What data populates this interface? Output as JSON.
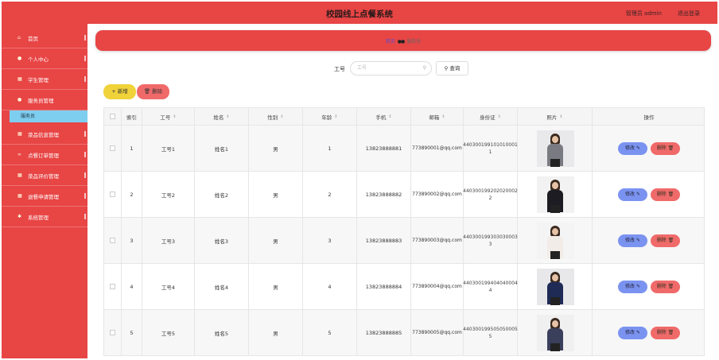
{
  "header": {
    "title": "校园线上点餐系统",
    "user": "管理员 admin",
    "logout": "退出登录"
  },
  "sidebar": {
    "items": [
      {
        "label": "首页",
        "icon": "home-icon",
        "glyph": "⌂"
      },
      {
        "label": "个人中心",
        "icon": "user-icon",
        "glyph": "●"
      },
      {
        "label": "学生管理",
        "icon": "grid-icon",
        "glyph": "▦"
      },
      {
        "label": "服务员管理",
        "icon": "user-icon",
        "glyph": "●"
      },
      {
        "label": "菜品信息管理",
        "icon": "grid-icon",
        "glyph": "▦"
      },
      {
        "label": "点餐订单管理",
        "icon": "link-icon",
        "glyph": "∞"
      },
      {
        "label": "菜品评价管理",
        "icon": "grid-icon",
        "glyph": "▦"
      },
      {
        "label": "退餐申请管理",
        "icon": "grid-icon",
        "glyph": "▦"
      },
      {
        "label": "系统管理",
        "icon": "gear-icon",
        "glyph": "✱"
      }
    ],
    "active_sub": "服务员"
  },
  "breadcrumb": {
    "home": "首页",
    "current": "服务员"
  },
  "search": {
    "label": "工号",
    "placeholder": "工号",
    "button": "查询"
  },
  "toolbar": {
    "add": "新增",
    "delete": "删除"
  },
  "table": {
    "columns": [
      "索引",
      "工号",
      "姓名",
      "性别",
      "年龄",
      "手机",
      "邮箱",
      "身份证",
      "照片",
      "操作"
    ],
    "rows": [
      {
        "index": "1",
        "id": "工号1",
        "name": "姓名1",
        "gender": "男",
        "age": "1",
        "phone": "13823888881",
        "email": "773890001@qq.com",
        "idcard_a": "440300199101010001",
        "idcard_b": "1"
      },
      {
        "index": "2",
        "id": "工号2",
        "name": "姓名2",
        "gender": "男",
        "age": "2",
        "phone": "13823888882",
        "email": "773890002@qq.com",
        "idcard_a": "440300199202020002",
        "idcard_b": "2"
      },
      {
        "index": "3",
        "id": "工号3",
        "name": "姓名3",
        "gender": "男",
        "age": "3",
        "phone": "13823888883",
        "email": "773890003@qq.com",
        "idcard_a": "440300199303030003",
        "idcard_b": "3"
      },
      {
        "index": "4",
        "id": "工号4",
        "name": "姓名4",
        "gender": "男",
        "age": "4",
        "phone": "13823888884",
        "email": "773890004@qq.com",
        "idcard_a": "440300199404040004",
        "idcard_b": "4"
      },
      {
        "index": "5",
        "id": "工号5",
        "name": "姓名5",
        "gender": "男",
        "age": "5",
        "phone": "13823888885",
        "email": "773890005@qq.com",
        "idcard_a": "440300199505050005",
        "idcard_b": "5"
      }
    ],
    "edit_label": "修改",
    "delete_label": "删除"
  },
  "colors": {
    "primary": "#e84545",
    "sub_active": "#7ecef0",
    "add": "#f0d23a",
    "edit": "#7b93f0",
    "danger": "#f06a6a"
  }
}
